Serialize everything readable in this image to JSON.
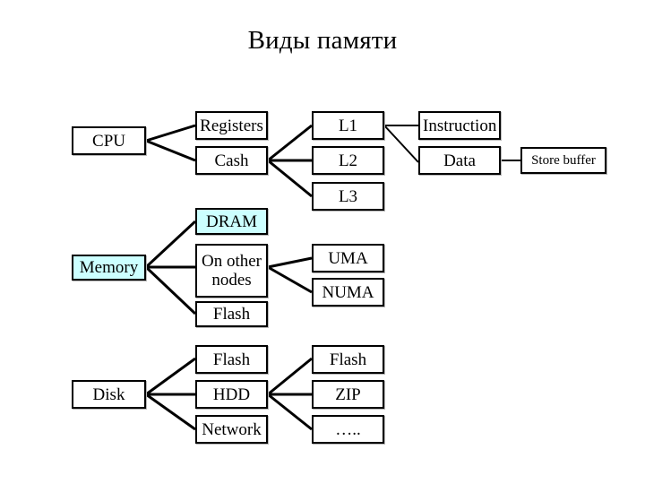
{
  "title": "Виды памяти",
  "colors": {
    "line": "#000000",
    "box_border": "#000000",
    "box_fill": "#ffffff",
    "highlight_fill": "#ccffff",
    "text": "#000000"
  },
  "diagram": {
    "type": "tree-diagram",
    "groups": [
      {
        "name": "cpu-group",
        "root": "CPU",
        "children": [
          "Registers",
          "Cash"
        ],
        "grandchildren": {
          "Cash": [
            "L1",
            "L2",
            "L3"
          ]
        }
      },
      {
        "name": "cache-detail-group",
        "root": "L1",
        "children": [
          "Instruction",
          "Data"
        ],
        "grandchildren": {
          "Data": [
            "Store buffer"
          ]
        }
      },
      {
        "name": "memory-group",
        "root": "Memory",
        "children": [
          "DRAM",
          "On other nodes",
          "Flash"
        ],
        "grandchildren": {
          "On other nodes": [
            "UMA",
            "NUMA"
          ]
        }
      },
      {
        "name": "disk-group",
        "root": "Disk",
        "children": [
          "Flash",
          "HDD",
          "Network"
        ],
        "grandchildren": {
          "HDD": [
            "Flash",
            "ZIP",
            "….."
          ]
        }
      }
    ],
    "nodes": {
      "cpu": "CPU",
      "registers": "Registers",
      "cash": "Cash",
      "l1": "L1",
      "l2": "L2",
      "l3": "L3",
      "instruction": "Instruction",
      "data": "Data",
      "store_buffer": "Store buffer",
      "memory": "Memory",
      "dram": "DRAM",
      "on_other_nodes_line1": "On other",
      "on_other_nodes_line2": "nodes",
      "flash_memory": "Flash",
      "uma": "UMA",
      "numa": "NUMA",
      "disk": "Disk",
      "disk_flash": "Flash",
      "hdd": "HDD",
      "network": "Network",
      "hdd_flash": "Flash",
      "zip": "ZIP",
      "ellipsis": "….."
    }
  }
}
